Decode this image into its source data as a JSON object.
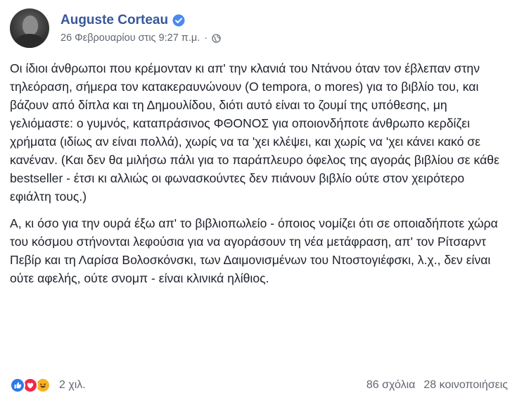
{
  "post": {
    "author": "Auguste Corteau",
    "timestamp": "26 Φεβρουαρίου στις 9:27 π.μ.",
    "separator": "·",
    "paragraphs": [
      "Οι ίδιοι άνθρωποι που κρέμονταν κι απ' την κλανιά του Ντάνου όταν τον έβλεπαν στην τηλεόραση, σήμερα τον κατακεραυνώνουν (O tempora, o mores) για το βιβλίο του, και βάζουν από δίπλα και τη Δημουλίδου, διότι αυτό είναι το ζουμί της υπόθεσης, μη γελιόμαστε: ο γυμνός, καταπράσινος ΦΘΟΝΟΣ για οποιονδήποτε άνθρωπο κερδίζει χρήματα (ιδίως αν είναι πολλά), χωρίς να τα 'χει κλέψει, και χωρίς να 'χει κάνει κακό σε κανέναν. (Και δεν θα μιλήσω πάλι για το παράπλευρο όφελος της αγοράς βιβλίου σε κάθε bestseller - έτσι κι αλλιώς οι φωνασκούντες δεν πιάνουν βιβλίο ούτε στον χειρότερο εφιάλτη τους.)",
      "Α, κι όσο για την ουρά έξω απ' το βιβλιοπωλείο - όποιος νομίζει ότι σε οποιαδήποτε χώρα του κόσμου στήνονται λεφούσια για να αγοράσουν τη νέα μετάφραση, απ' τον Ρίτσαρντ Πεβίρ και τη Λαρίσα Βολοσκόνσκι, των Δαιμονισμένων του Ντοστογιέφσκι, λ.χ., δεν είναι ούτε αφελής, ούτε σνομπ - είναι κλινικά ηλίθιος."
    ],
    "reactions_count": "2 χιλ.",
    "comments": "86 σχόλια",
    "shares": "28 κοινοποιήσεις"
  },
  "icons": {
    "verified": "verified-badge-icon",
    "privacy": "globe-icon",
    "reactions": [
      "like-icon",
      "love-icon",
      "haha-icon"
    ]
  },
  "colors": {
    "name": "#385898",
    "text": "#1d2129",
    "meta": "#616770",
    "verified": "#4a89f3",
    "like": "#2f79ea",
    "love": "#f0284a",
    "haha": "#f7b125"
  }
}
